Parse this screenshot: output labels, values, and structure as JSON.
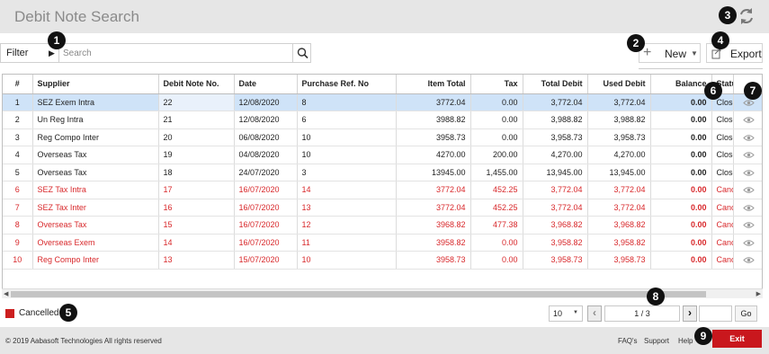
{
  "header": {
    "title": "Debit Note Search",
    "refresh_icon": "refresh-icon"
  },
  "toolbar": {
    "filter_label": "Filter",
    "search_placeholder": "Search",
    "new_label": "New",
    "export_label": "Export"
  },
  "callouts": [
    "1",
    "2",
    "3",
    "4",
    "5",
    "6",
    "7",
    "8",
    "9"
  ],
  "table": {
    "columns": [
      "#",
      "Supplier",
      "Debit Note No.",
      "Date",
      "Purchase Ref. No",
      "Item Total",
      "Tax",
      "Total Debit",
      "Used Debit",
      "Balance",
      "Statu",
      "",
      ""
    ],
    "rows": [
      {
        "n": "1",
        "supplier": "SEZ Exem Intra",
        "debit_note_no": "22",
        "date": "12/08/2020",
        "purchase_ref": "8",
        "item_total": "3772.04",
        "tax": "0.00",
        "total_debit": "3,772.04",
        "used_debit": "3,772.04",
        "balance": "0.00",
        "status": "Close"
      },
      {
        "n": "2",
        "supplier": "Un Reg Intra",
        "debit_note_no": "21",
        "date": "12/08/2020",
        "purchase_ref": "6",
        "item_total": "3988.82",
        "tax": "0.00",
        "total_debit": "3,988.82",
        "used_debit": "3,988.82",
        "balance": "0.00",
        "status": "Close"
      },
      {
        "n": "3",
        "supplier": "Reg Compo Inter",
        "debit_note_no": "20",
        "date": "06/08/2020",
        "purchase_ref": "10",
        "item_total": "3958.73",
        "tax": "0.00",
        "total_debit": "3,958.73",
        "used_debit": "3,958.73",
        "balance": "0.00",
        "status": "Close"
      },
      {
        "n": "4",
        "supplier": "Overseas Tax",
        "debit_note_no": "19",
        "date": "04/08/2020",
        "purchase_ref": "10",
        "item_total": "4270.00",
        "tax": "200.00",
        "total_debit": "4,270.00",
        "used_debit": "4,270.00",
        "balance": "0.00",
        "status": "Close"
      },
      {
        "n": "5",
        "supplier": "Overseas Tax",
        "debit_note_no": "18",
        "date": "24/07/2020",
        "purchase_ref": "3",
        "item_total": "13945.00",
        "tax": "1,455.00",
        "total_debit": "13,945.00",
        "used_debit": "13,945.00",
        "balance": "0.00",
        "status": "Close"
      },
      {
        "n": "6",
        "supplier": "SEZ Tax Intra",
        "debit_note_no": "17",
        "date": "16/07/2020",
        "purchase_ref": "14",
        "item_total": "3772.04",
        "tax": "452.25",
        "total_debit": "3,772.04",
        "used_debit": "3,772.04",
        "balance": "0.00",
        "status": "Canc"
      },
      {
        "n": "7",
        "supplier": "SEZ Tax Inter",
        "debit_note_no": "16",
        "date": "16/07/2020",
        "purchase_ref": "13",
        "item_total": "3772.04",
        "tax": "452.25",
        "total_debit": "3,772.04",
        "used_debit": "3,772.04",
        "balance": "0.00",
        "status": "Canc"
      },
      {
        "n": "8",
        "supplier": "Overseas Tax",
        "debit_note_no": "15",
        "date": "16/07/2020",
        "purchase_ref": "12",
        "item_total": "3968.82",
        "tax": "477.38",
        "total_debit": "3,968.82",
        "used_debit": "3,968.82",
        "balance": "0.00",
        "status": "Canc"
      },
      {
        "n": "9",
        "supplier": "Overseas Exem",
        "debit_note_no": "14",
        "date": "16/07/2020",
        "purchase_ref": "11",
        "item_total": "3958.82",
        "tax": "0.00",
        "total_debit": "3,958.82",
        "used_debit": "3,958.82",
        "balance": "0.00",
        "status": "Canc"
      },
      {
        "n": "10",
        "supplier": "Reg Compo Inter",
        "debit_note_no": "13",
        "date": "15/07/2020",
        "purchase_ref": "10",
        "item_total": "3958.73",
        "tax": "0.00",
        "total_debit": "3,958.73",
        "used_debit": "3,958.73",
        "balance": "0.00",
        "status": "Canc"
      }
    ],
    "cancelled_rows": [
      6,
      7,
      8,
      9,
      10
    ],
    "selected_row": 1,
    "row_icons": [
      "eye-icon",
      "circle-icon"
    ]
  },
  "legend": {
    "cancelled_label": "Cancelled",
    "cancelled_color": "#cc1f1f"
  },
  "pager": {
    "page_size": "10",
    "page_info": "1 / 3",
    "go_label": "Go"
  },
  "footer": {
    "copyright": "© 2019 Aabasoft Technologies All rights reserved",
    "faqs": "FAQ's",
    "support": "Support",
    "help": "Help",
    "exit": "Exit",
    "exit_color": "#c9171d"
  }
}
